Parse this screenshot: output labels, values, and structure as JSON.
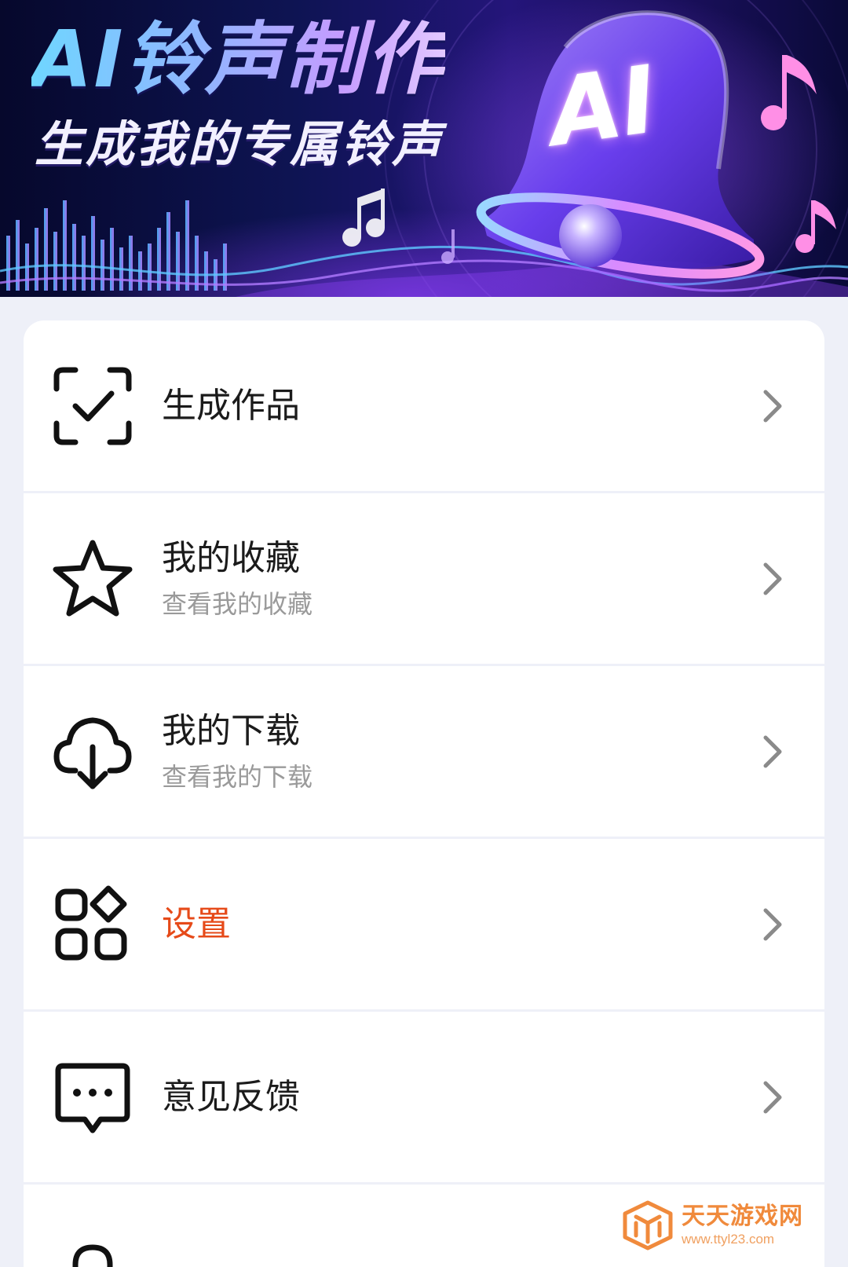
{
  "banner": {
    "title": "AI铃声制作",
    "subtitle": "生成我的专属铃声",
    "bell_label": "AI"
  },
  "menu": {
    "items": [
      {
        "icon": "scan-check-icon",
        "label": "生成作品",
        "sublabel": ""
      },
      {
        "icon": "star-icon",
        "label": "我的收藏",
        "sublabel": "查看我的收藏"
      },
      {
        "icon": "cloud-download-icon",
        "label": "我的下载",
        "sublabel": "查看我的下载"
      },
      {
        "icon": "apps-grid-icon",
        "label": "设置",
        "sublabel": ""
      },
      {
        "icon": "message-dots-icon",
        "label": "意见反馈",
        "sublabel": ""
      },
      {
        "icon": "lock-icon",
        "label": "",
        "sublabel": ""
      }
    ]
  },
  "colors": {
    "accent_label": "#e64a19",
    "page_bg": "#eef0f8"
  },
  "watermark": {
    "name": "天天游戏网",
    "url": "www.ttyl23.com"
  }
}
